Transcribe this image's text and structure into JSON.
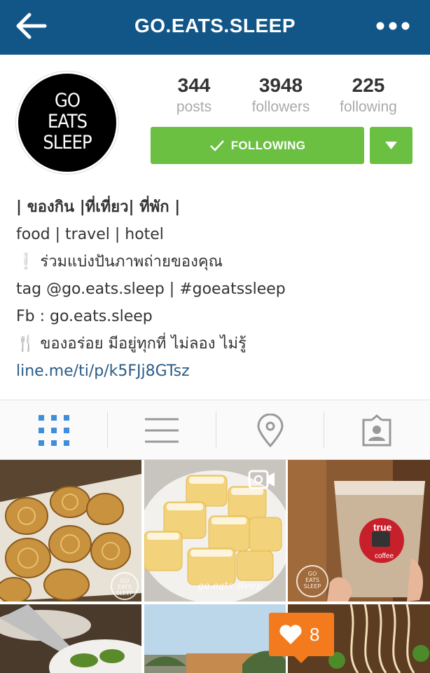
{
  "header": {
    "title": "GO.EATS.SLEEP",
    "back_icon": "back-arrow-icon",
    "more_icon": "more-dots-icon",
    "bar_color": "#125688"
  },
  "profile": {
    "avatar_lines": [
      "GO",
      "EATS",
      "SLEEP"
    ],
    "stats": [
      {
        "value": "344",
        "label": "posts"
      },
      {
        "value": "3948",
        "label": "followers"
      },
      {
        "value": "225",
        "label": "following"
      }
    ],
    "follow_button": "FOLLOWING",
    "follow_color": "#6bc042"
  },
  "bio": {
    "line1": "| ของกิน |ที่เที่ยว| ที่พัก |",
    "line2": "food | travel | hotel",
    "line3": "❕ ร่วมแบ่งปันภาพถ่ายของคุณ",
    "line4": "tag @go.eats.sleep | #goeatssleep",
    "line5": "Fb : go.eats.sleep",
    "line6": "🍴 ของอร่อย มีอยู่ทุกที่ ไม่ลอง ไม่รู้",
    "link": "line.me/ti/p/k5FJj8GTsz"
  },
  "tabs": [
    {
      "name": "grid-view",
      "icon": "grid-icon",
      "active": true
    },
    {
      "name": "list-view",
      "icon": "list-icon",
      "active": false
    },
    {
      "name": "map-view",
      "icon": "location-pin-icon",
      "active": false
    },
    {
      "name": "tagged-photos",
      "icon": "tagged-person-icon",
      "active": false
    }
  ],
  "grid": {
    "watermark": "go.eats.sleep",
    "logo_lines": [
      "GO",
      "EATS",
      "SLEEP"
    ],
    "cup_brand": "true",
    "cup_sub": "coffee"
  },
  "notification": {
    "likes": "8",
    "color": "#f37b1d"
  }
}
